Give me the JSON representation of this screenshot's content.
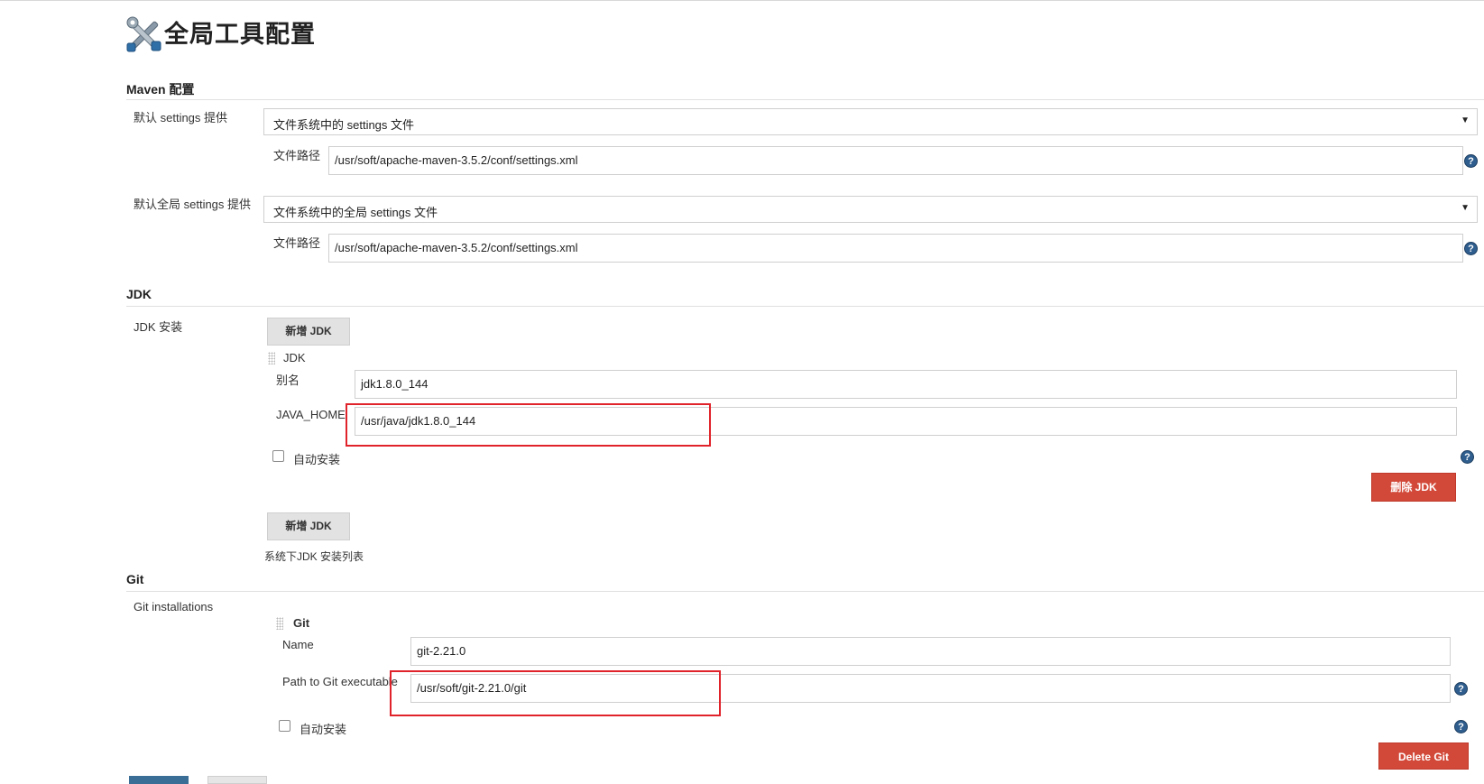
{
  "page": {
    "title": "全局工具配置"
  },
  "maven": {
    "section_title": "Maven 配置",
    "settings_label": "默认 settings 提供",
    "settings_value": "文件系统中的 settings 文件",
    "settings_path_label": "文件路径",
    "settings_path_value": "/usr/soft/apache-maven-3.5.2/conf/settings.xml",
    "global_settings_label": "默认全局 settings 提供",
    "global_settings_value": "文件系统中的全局 settings 文件",
    "global_path_label": "文件路径",
    "global_path_value": "/usr/soft/apache-maven-3.5.2/conf/settings.xml"
  },
  "jdk": {
    "section_title": "JDK",
    "install_label": "JDK 安装",
    "add_button": "新增 JDK",
    "item_header": "JDK",
    "alias_label": "别名",
    "alias_value": "jdk1.8.0_144",
    "java_home_label": "JAVA_HOME",
    "java_home_value": "/usr/java/jdk1.8.0_144",
    "auto_install_label": "自动安装",
    "delete_button": "删除 JDK",
    "add_button_2": "新增 JDK",
    "list_note": "系统下JDK 安装列表"
  },
  "git": {
    "section_title": "Git",
    "installations_label": "Git installations",
    "item_header": "Git",
    "name_label": "Name",
    "name_value": "git-2.21.0",
    "path_label": "Path to Git executable",
    "path_value": "/usr/soft/git-2.21.0/git",
    "auto_install_label": "自动安装",
    "delete_button": "Delete Git"
  },
  "icons": {
    "help": "help-icon",
    "tools": "tools-icon",
    "dropdown": "dropdown-arrow-icon"
  },
  "colors": {
    "delete_button": "#d24939",
    "highlight_box": "#e0232b",
    "help_icon": "#2f5e8e",
    "save_button": "#3b6e96"
  }
}
